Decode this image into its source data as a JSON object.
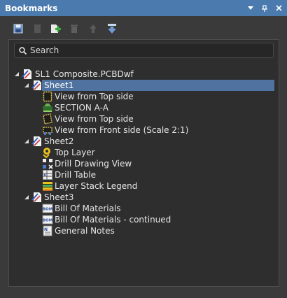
{
  "window": {
    "title": "Bookmarks"
  },
  "search": {
    "placeholder": "Search"
  },
  "tree": {
    "root": "SL1 Composite.PCBDwf",
    "sheet1": {
      "label": "Sheet1",
      "items": [
        "View from Top side",
        "SECTION A-A",
        "View from Top side",
        "View from Front side (Scale 2:1)"
      ]
    },
    "sheet2": {
      "label": "Sheet2",
      "items": [
        "Top Layer",
        "Drill Drawing View",
        "Drill Table",
        "Layer Stack Legend"
      ]
    },
    "sheet3": {
      "label": "Sheet3",
      "items": [
        "Bill Of Materials",
        "Bill Of Materials - continued",
        "General Notes"
      ]
    }
  },
  "icons": {
    "bom_label": "BOM",
    "notes_label": "N"
  },
  "colors": {
    "titlebar": "#4a7aae",
    "selection": "#4f72a0",
    "panel": "#2e2e2e"
  }
}
